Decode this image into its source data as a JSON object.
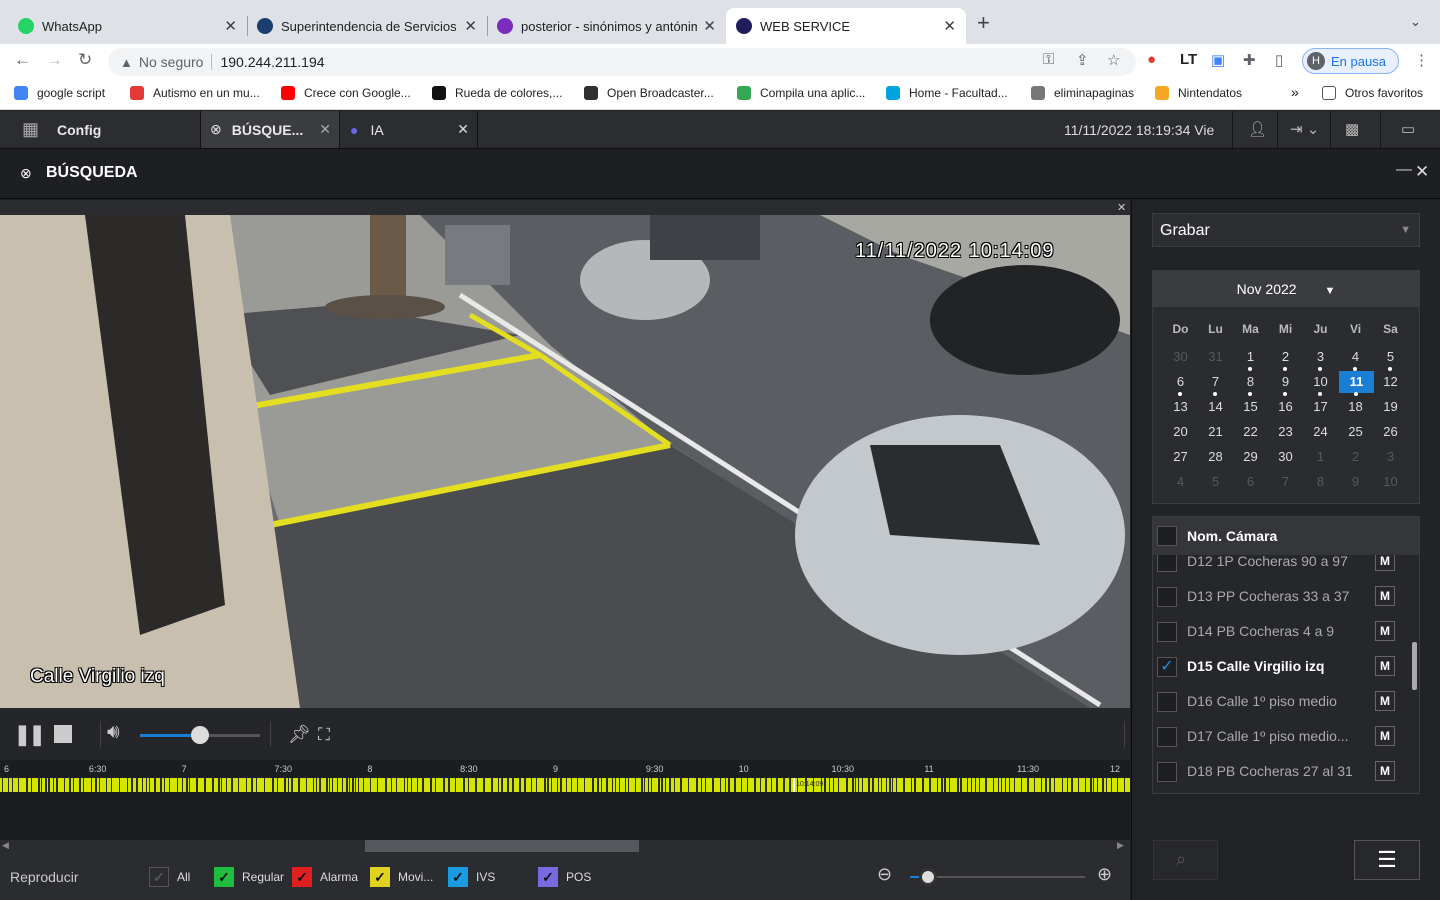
{
  "browser": {
    "tabs": [
      {
        "title": "WhatsApp",
        "favicon_color": "#25d366"
      },
      {
        "title": "Superintendencia de Servicios",
        "favicon_color": "#1a3e6e"
      },
      {
        "title": "posterior - sinónimos y antónim",
        "favicon_color": "#7b2cbf"
      },
      {
        "title": "WEB SERVICE",
        "favicon_color": "#1e1e5a"
      }
    ],
    "active_tab_index": 3,
    "address": {
      "security": "No seguro",
      "url": "190.244.211.194"
    },
    "profile": {
      "initial": "H",
      "label": "En pausa"
    },
    "bookmarks": [
      {
        "label": "google script",
        "color": "#4285f4"
      },
      {
        "label": "Autismo en un mu...",
        "color": "#e53935"
      },
      {
        "label": "Crece con Google...",
        "color": "#ff0000"
      },
      {
        "label": "Rueda de colores,...",
        "color": "#111111"
      },
      {
        "label": "Open Broadcaster...",
        "color": "#302e31"
      },
      {
        "label": "Compila una aplic...",
        "color": "#34a853"
      },
      {
        "label": "Home - Facultad...",
        "color": "#00a3e0"
      },
      {
        "label": "eliminapaginas",
        "color": "#777777"
      },
      {
        "label": "Nintendatos",
        "color": "#f5a623"
      }
    ],
    "other_bookmarks": "Otros favoritos",
    "more_bookmarks": "»"
  },
  "app": {
    "config_label": "Config",
    "tabs": [
      {
        "label": "BÚSQUE..."
      },
      {
        "label": "IA"
      }
    ],
    "datetime": "11/11/2022 18:19:34 Vie",
    "panel_title": "BÚSQUEDA"
  },
  "video": {
    "timestamp": "11/11/2022 10:14:09",
    "camera_label": "Calle Virgilio izq",
    "volume": 0.5
  },
  "timeline": {
    "ticks": [
      "6",
      "6:30",
      "7",
      "7:30",
      "8",
      "8:30",
      "9",
      "9:30",
      "10",
      "10:30",
      "11",
      "11:30",
      "12"
    ],
    "cursor_label": "10:14:09",
    "record_color": "#d4e600"
  },
  "bottom": {
    "reproducir": "Reproducir",
    "legend": [
      {
        "label": "All",
        "color": "#2a2c30",
        "checked": true
      },
      {
        "label": "Regular",
        "color": "#1fbe3e",
        "checked": true
      },
      {
        "label": "Alarma",
        "color": "#e02020",
        "checked": true
      },
      {
        "label": "Movi...",
        "color": "#e0d21f",
        "checked": true
      },
      {
        "label": "IVS",
        "color": "#1a9be0",
        "checked": true
      },
      {
        "label": "POS",
        "color": "#7a6ae0",
        "checked": true
      }
    ],
    "zoom_level": 0.1
  },
  "right": {
    "record_type": "Grabar",
    "calendar": {
      "month": "Nov 2022",
      "dow": [
        "Do",
        "Lu",
        "Ma",
        "Mi",
        "Ju",
        "Vi",
        "Sa"
      ],
      "weeks": [
        [
          {
            "d": "30",
            "o": true
          },
          {
            "d": "31",
            "o": true
          },
          {
            "d": "1",
            "dot": true
          },
          {
            "d": "2",
            "dot": true
          },
          {
            "d": "3",
            "dot": true
          },
          {
            "d": "4",
            "dot": true
          },
          {
            "d": "5",
            "dot": true
          }
        ],
        [
          {
            "d": "6",
            "dot": true
          },
          {
            "d": "7",
            "dot": true
          },
          {
            "d": "8",
            "dot": true
          },
          {
            "d": "9",
            "dot": true
          },
          {
            "d": "10",
            "dot": true
          },
          {
            "d": "11",
            "sel": true,
            "dot": true
          },
          {
            "d": "12"
          }
        ],
        [
          {
            "d": "13"
          },
          {
            "d": "14"
          },
          {
            "d": "15"
          },
          {
            "d": "16"
          },
          {
            "d": "17"
          },
          {
            "d": "18"
          },
          {
            "d": "19"
          }
        ],
        [
          {
            "d": "20"
          },
          {
            "d": "21"
          },
          {
            "d": "22"
          },
          {
            "d": "23"
          },
          {
            "d": "24"
          },
          {
            "d": "25"
          },
          {
            "d": "26"
          }
        ],
        [
          {
            "d": "27"
          },
          {
            "d": "28"
          },
          {
            "d": "29"
          },
          {
            "d": "30"
          },
          {
            "d": "1",
            "o": true
          },
          {
            "d": "2",
            "o": true
          },
          {
            "d": "3",
            "o": true
          }
        ],
        [
          {
            "d": "4",
            "o": true
          },
          {
            "d": "5",
            "o": true
          },
          {
            "d": "6",
            "o": true
          },
          {
            "d": "7",
            "o": true
          },
          {
            "d": "8",
            "o": true
          },
          {
            "d": "9",
            "o": true
          },
          {
            "d": "10",
            "o": true
          }
        ]
      ]
    },
    "cam_header": "Nom. Cámara",
    "cameras": [
      {
        "name": "D12 1P Cocheras 90 a 97",
        "checked": false
      },
      {
        "name": "D13 PP Cocheras 33 a 37",
        "checked": false
      },
      {
        "name": "D14 PB Cocheras 4 a 9",
        "checked": false
      },
      {
        "name": "D15 Calle Virgilio izq",
        "checked": true
      },
      {
        "name": "D16 Calle 1º piso medio",
        "checked": false
      },
      {
        "name": "D17 Calle 1º piso medio...",
        "checked": false
      },
      {
        "name": "D18 PB Cocheras 27 al 31",
        "checked": false
      }
    ],
    "m_label": "M"
  }
}
